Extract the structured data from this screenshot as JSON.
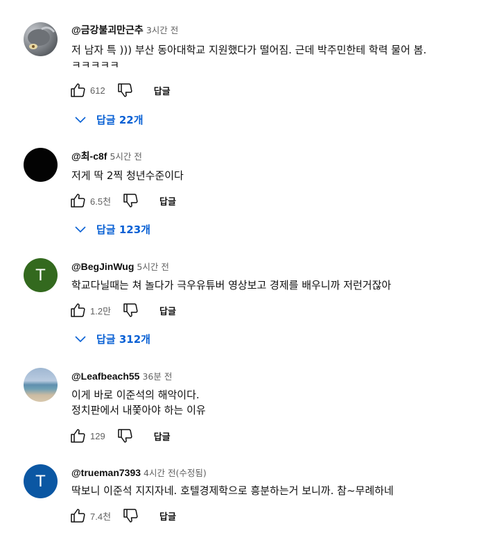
{
  "comments": [
    {
      "author": "@금강불괴만근추",
      "time": "3시간 전",
      "lines": [
        "저 남자 특 ))) 부산 동아대학교 지원했다가 떨어짐. 근데 박주민한테 학력 물어 봄.",
        "ㅋㅋㅋㅋㅋ"
      ],
      "likes": "612",
      "reply_label": "답글",
      "replies": "답글 22개"
    },
    {
      "author": "@최-c8f",
      "time": "5시간 전",
      "lines": [
        "저게 딱 2찍 청년수준이다"
      ],
      "likes": "6.5천",
      "reply_label": "답글",
      "replies": "답글 123개"
    },
    {
      "author": "@BegJinWug",
      "time": "5시간 전",
      "avatar_letter": "T",
      "lines": [
        "학교다닐때는 쳐 놀다가 극우유튜버 영상보고 경제를 배우니까 저런거잖아"
      ],
      "likes": "1.2만",
      "reply_label": "답글",
      "replies": "답글 312개"
    },
    {
      "author": "@Leafbeach55",
      "time": "36분 전",
      "lines": [
        "이게 바로 이준석의 해악이다.",
        "정치판에서 내쫓아야 하는 이유"
      ],
      "likes": "129",
      "reply_label": "답글"
    },
    {
      "author": "@trueman7393",
      "time": "4시간 전(수정됨)",
      "avatar_letter": "T",
      "lines": [
        "딱보니 이준석 지지자네. 호텔경제학으로 흥분하는거 보니까. 참~무례하네"
      ],
      "likes": "7.4천",
      "reply_label": "답글"
    }
  ],
  "icons": {
    "like": "thumbs-up-icon",
    "dislike": "thumbs-down-icon",
    "expand": "chevron-down-icon"
  },
  "colors": {
    "link_blue": "#065fd4",
    "secondary_text": "#606060"
  }
}
